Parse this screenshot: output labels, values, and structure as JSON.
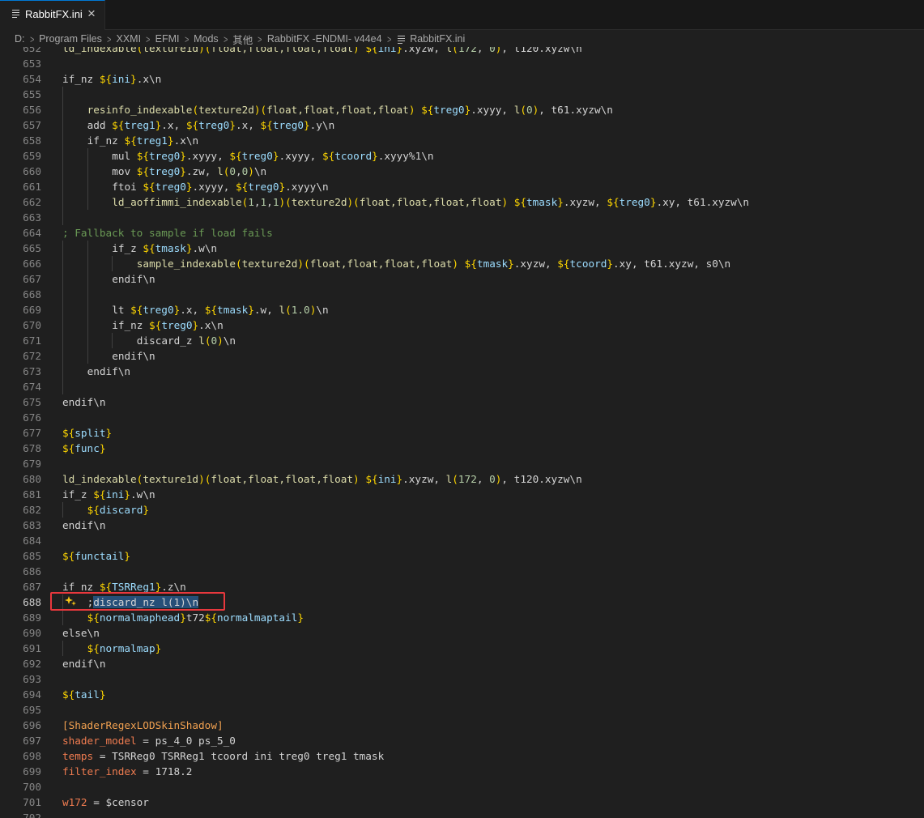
{
  "tab": {
    "label": "RabbitFX.ini",
    "close": "×"
  },
  "breadcrumb": [
    "D:",
    "Program Files",
    "XXMI",
    "EFMI",
    "Mods",
    "其他",
    "RabbitFX -ENDMI- v44e4",
    "RabbitFX.ini"
  ],
  "colors": {
    "active_tab_border": "#0078d4",
    "annotation_box": "#e8383d",
    "selection": "#264f78",
    "editor_bg": "#1f1f1f"
  },
  "editor": {
    "active_line": "688",
    "lines": [
      {
        "n": "652",
        "indent": 0,
        "segs": [
          [
            "ld_indexable",
            "func"
          ],
          [
            "(",
            "brace"
          ],
          [
            "texture1d",
            "func"
          ],
          [
            ")",
            "brace"
          ],
          [
            "(",
            "brace"
          ],
          [
            "float,float,float,float",
            "func"
          ],
          [
            ")",
            "brace"
          ],
          [
            " ",
            ""
          ],
          [
            "${",
            "brace"
          ],
          [
            "ini",
            "var"
          ],
          [
            "}",
            "brace"
          ],
          [
            ".xyzw, ",
            ""
          ],
          [
            "l",
            "func"
          ],
          [
            "(",
            "brace"
          ],
          [
            "172",
            "num"
          ],
          [
            ", ",
            ""
          ],
          [
            "0",
            "num"
          ],
          [
            ")",
            "brace"
          ],
          [
            ", t120.xyzw\\n",
            ""
          ]
        ]
      },
      {
        "n": "653",
        "indent": 0,
        "segs": []
      },
      {
        "n": "654",
        "indent": 0,
        "segs": [
          [
            "if_nz ",
            ""
          ],
          [
            "${",
            "brace"
          ],
          [
            "ini",
            "var"
          ],
          [
            "}",
            "brace"
          ],
          [
            ".x\\n",
            ""
          ]
        ]
      },
      {
        "n": "655",
        "indent": 1,
        "segs": []
      },
      {
        "n": "656",
        "indent": 1,
        "segs": [
          [
            "resinfo_indexable",
            "func"
          ],
          [
            "(",
            "brace"
          ],
          [
            "texture2d",
            "func"
          ],
          [
            ")",
            "brace"
          ],
          [
            "(",
            "brace"
          ],
          [
            "float,float,float,float",
            "func"
          ],
          [
            ")",
            "brace"
          ],
          [
            " ",
            ""
          ],
          [
            "${",
            "brace"
          ],
          [
            "treg0",
            "var"
          ],
          [
            "}",
            "brace"
          ],
          [
            ".xyyy, ",
            ""
          ],
          [
            "l",
            "func"
          ],
          [
            "(",
            "brace"
          ],
          [
            "0",
            "num"
          ],
          [
            ")",
            "brace"
          ],
          [
            ", t61.xyzw\\n",
            ""
          ]
        ]
      },
      {
        "n": "657",
        "indent": 1,
        "segs": [
          [
            "add ",
            ""
          ],
          [
            "${",
            "brace"
          ],
          [
            "treg1",
            "var"
          ],
          [
            "}",
            "brace"
          ],
          [
            ".x, ",
            ""
          ],
          [
            "${",
            "brace"
          ],
          [
            "treg0",
            "var"
          ],
          [
            "}",
            "brace"
          ],
          [
            ".x, ",
            ""
          ],
          [
            "${",
            "brace"
          ],
          [
            "treg0",
            "var"
          ],
          [
            "}",
            "brace"
          ],
          [
            ".y\\n",
            ""
          ]
        ]
      },
      {
        "n": "658",
        "indent": 1,
        "segs": [
          [
            "if_nz ",
            ""
          ],
          [
            "${",
            "brace"
          ],
          [
            "treg1",
            "var"
          ],
          [
            "}",
            "brace"
          ],
          [
            ".x\\n",
            ""
          ]
        ]
      },
      {
        "n": "659",
        "indent": 2,
        "segs": [
          [
            "mul ",
            ""
          ],
          [
            "${",
            "brace"
          ],
          [
            "treg0",
            "var"
          ],
          [
            "}",
            "brace"
          ],
          [
            ".xyyy, ",
            ""
          ],
          [
            "${",
            "brace"
          ],
          [
            "treg0",
            "var"
          ],
          [
            "}",
            "brace"
          ],
          [
            ".xyyy, ",
            ""
          ],
          [
            "${",
            "brace"
          ],
          [
            "tcoord",
            "var"
          ],
          [
            "}",
            "brace"
          ],
          [
            ".xyyy%1\\n",
            ""
          ]
        ]
      },
      {
        "n": "660",
        "indent": 2,
        "segs": [
          [
            "mov ",
            ""
          ],
          [
            "${",
            "brace"
          ],
          [
            "treg0",
            "var"
          ],
          [
            "}",
            "brace"
          ],
          [
            ".zw, ",
            ""
          ],
          [
            "l",
            "func"
          ],
          [
            "(",
            "brace"
          ],
          [
            "0",
            "num"
          ],
          [
            ",",
            ""
          ],
          [
            "0",
            "num"
          ],
          [
            ")",
            "brace"
          ],
          [
            "\\n",
            ""
          ]
        ]
      },
      {
        "n": "661",
        "indent": 2,
        "segs": [
          [
            "ftoi ",
            ""
          ],
          [
            "${",
            "brace"
          ],
          [
            "treg0",
            "var"
          ],
          [
            "}",
            "brace"
          ],
          [
            ".xyyy, ",
            ""
          ],
          [
            "${",
            "brace"
          ],
          [
            "treg0",
            "var"
          ],
          [
            "}",
            "brace"
          ],
          [
            ".xyyy\\n",
            ""
          ]
        ]
      },
      {
        "n": "662",
        "indent": 2,
        "segs": [
          [
            "ld_aoffimmi_indexable",
            "func"
          ],
          [
            "(",
            "brace"
          ],
          [
            "1",
            "num"
          ],
          [
            ",",
            ""
          ],
          [
            "1",
            "num"
          ],
          [
            ",",
            ""
          ],
          [
            "1",
            "num"
          ],
          [
            ")",
            "brace"
          ],
          [
            "(",
            "brace"
          ],
          [
            "texture2d",
            "func"
          ],
          [
            ")",
            "brace"
          ],
          [
            "(",
            "brace"
          ],
          [
            "float,float,float,float",
            "func"
          ],
          [
            ")",
            "brace"
          ],
          [
            " ",
            ""
          ],
          [
            "${",
            "brace"
          ],
          [
            "tmask",
            "var"
          ],
          [
            "}",
            "brace"
          ],
          [
            ".xyzw, ",
            ""
          ],
          [
            "${",
            "brace"
          ],
          [
            "treg0",
            "var"
          ],
          [
            "}",
            "brace"
          ],
          [
            ".xy, t61.xyzw\\n",
            ""
          ]
        ]
      },
      {
        "n": "663",
        "indent": 1,
        "segs": []
      },
      {
        "n": "664",
        "indent": 0,
        "segs": [
          [
            "; Fallback to sample if load fails",
            "comment"
          ]
        ]
      },
      {
        "n": "665",
        "indent": 2,
        "segs": [
          [
            "if_z ",
            ""
          ],
          [
            "${",
            "brace"
          ],
          [
            "tmask",
            "var"
          ],
          [
            "}",
            "brace"
          ],
          [
            ".w\\n",
            ""
          ]
        ]
      },
      {
        "n": "666",
        "indent": 3,
        "segs": [
          [
            "sample_indexable",
            "func"
          ],
          [
            "(",
            "brace"
          ],
          [
            "texture2d",
            "func"
          ],
          [
            ")",
            "brace"
          ],
          [
            "(",
            "brace"
          ],
          [
            "float,float,float,float",
            "func"
          ],
          [
            ")",
            "brace"
          ],
          [
            " ",
            ""
          ],
          [
            "${",
            "brace"
          ],
          [
            "tmask",
            "var"
          ],
          [
            "}",
            "brace"
          ],
          [
            ".xyzw, ",
            ""
          ],
          [
            "${",
            "brace"
          ],
          [
            "tcoord",
            "var"
          ],
          [
            "}",
            "brace"
          ],
          [
            ".xy, t61.xyzw, s0\\n",
            ""
          ]
        ]
      },
      {
        "n": "667",
        "indent": 2,
        "segs": [
          [
            "endif\\n",
            ""
          ]
        ]
      },
      {
        "n": "668",
        "indent": 2,
        "segs": []
      },
      {
        "n": "669",
        "indent": 2,
        "segs": [
          [
            "lt ",
            ""
          ],
          [
            "${",
            "brace"
          ],
          [
            "treg0",
            "var"
          ],
          [
            "}",
            "brace"
          ],
          [
            ".x, ",
            ""
          ],
          [
            "${",
            "brace"
          ],
          [
            "tmask",
            "var"
          ],
          [
            "}",
            "brace"
          ],
          [
            ".w, ",
            ""
          ],
          [
            "l",
            "func"
          ],
          [
            "(",
            "brace"
          ],
          [
            "1.0",
            "num"
          ],
          [
            ")",
            "brace"
          ],
          [
            "\\n",
            ""
          ]
        ]
      },
      {
        "n": "670",
        "indent": 2,
        "segs": [
          [
            "if_nz ",
            ""
          ],
          [
            "${",
            "brace"
          ],
          [
            "treg0",
            "var"
          ],
          [
            "}",
            "brace"
          ],
          [
            ".x\\n",
            ""
          ]
        ]
      },
      {
        "n": "671",
        "indent": 3,
        "segs": [
          [
            "discard_z ",
            ""
          ],
          [
            "l",
            "func"
          ],
          [
            "(",
            "brace"
          ],
          [
            "0",
            "num"
          ],
          [
            ")",
            "brace"
          ],
          [
            "\\n",
            ""
          ]
        ]
      },
      {
        "n": "672",
        "indent": 2,
        "segs": [
          [
            "endif\\n",
            ""
          ]
        ]
      },
      {
        "n": "673",
        "indent": 1,
        "segs": [
          [
            "endif\\n",
            ""
          ]
        ]
      },
      {
        "n": "674",
        "indent": 1,
        "segs": []
      },
      {
        "n": "675",
        "indent": 0,
        "segs": [
          [
            "endif\\n",
            ""
          ]
        ]
      },
      {
        "n": "676",
        "indent": 0,
        "segs": []
      },
      {
        "n": "677",
        "indent": 0,
        "segs": [
          [
            "${",
            "brace"
          ],
          [
            "split",
            "var"
          ],
          [
            "}",
            "brace"
          ]
        ]
      },
      {
        "n": "678",
        "indent": 0,
        "segs": [
          [
            "${",
            "brace"
          ],
          [
            "func",
            "var"
          ],
          [
            "}",
            "brace"
          ]
        ]
      },
      {
        "n": "679",
        "indent": 0,
        "segs": []
      },
      {
        "n": "680",
        "indent": 0,
        "segs": [
          [
            "ld_indexable",
            "func"
          ],
          [
            "(",
            "brace"
          ],
          [
            "texture1d",
            "func"
          ],
          [
            ")",
            "brace"
          ],
          [
            "(",
            "brace"
          ],
          [
            "float,float,float,float",
            "func"
          ],
          [
            ")",
            "brace"
          ],
          [
            " ",
            ""
          ],
          [
            "${",
            "brace"
          ],
          [
            "ini",
            "var"
          ],
          [
            "}",
            "brace"
          ],
          [
            ".xyzw, ",
            ""
          ],
          [
            "l",
            "func"
          ],
          [
            "(",
            "brace"
          ],
          [
            "172",
            "num"
          ],
          [
            ", ",
            ""
          ],
          [
            "0",
            "num"
          ],
          [
            ")",
            "brace"
          ],
          [
            ", t120.xyzw\\n",
            ""
          ]
        ]
      },
      {
        "n": "681",
        "indent": 0,
        "segs": [
          [
            "if_z ",
            ""
          ],
          [
            "${",
            "brace"
          ],
          [
            "ini",
            "var"
          ],
          [
            "}",
            "brace"
          ],
          [
            ".w\\n",
            ""
          ]
        ]
      },
      {
        "n": "682",
        "indent": 1,
        "segs": [
          [
            "${",
            "brace"
          ],
          [
            "discard",
            "var"
          ],
          [
            "}",
            "brace"
          ]
        ]
      },
      {
        "n": "683",
        "indent": 0,
        "segs": [
          [
            "endif\\n",
            ""
          ]
        ]
      },
      {
        "n": "684",
        "indent": 0,
        "segs": []
      },
      {
        "n": "685",
        "indent": 0,
        "segs": [
          [
            "${",
            "brace"
          ],
          [
            "functail",
            "var"
          ],
          [
            "}",
            "brace"
          ]
        ]
      },
      {
        "n": "686",
        "indent": 0,
        "segs": []
      },
      {
        "n": "687",
        "indent": 0,
        "segs": [
          [
            "if_nz ",
            ""
          ],
          [
            "${",
            "brace"
          ],
          [
            "TSRReg1",
            "var"
          ],
          [
            "}",
            "brace"
          ],
          [
            ".z\\n",
            ""
          ]
        ]
      },
      {
        "n": "688",
        "indent": 1,
        "segs": [
          [
            ";",
            ""
          ],
          [
            "discard_nz l(1)\\n",
            "sel"
          ]
        ]
      },
      {
        "n": "689",
        "indent": 1,
        "segs": [
          [
            "${",
            "brace"
          ],
          [
            "normalmaphead",
            "var"
          ],
          [
            "}",
            "brace"
          ],
          [
            "t72",
            ""
          ],
          [
            "${",
            "brace"
          ],
          [
            "normalmaptail",
            "var"
          ],
          [
            "}",
            "brace"
          ]
        ]
      },
      {
        "n": "690",
        "indent": 0,
        "segs": [
          [
            "else\\n",
            ""
          ]
        ]
      },
      {
        "n": "691",
        "indent": 1,
        "segs": [
          [
            "${",
            "brace"
          ],
          [
            "normalmap",
            "var"
          ],
          [
            "}",
            "brace"
          ]
        ]
      },
      {
        "n": "692",
        "indent": 0,
        "segs": [
          [
            "endif\\n",
            ""
          ]
        ]
      },
      {
        "n": "693",
        "indent": 0,
        "segs": []
      },
      {
        "n": "694",
        "indent": 0,
        "segs": [
          [
            "${",
            "brace"
          ],
          [
            "tail",
            "var"
          ],
          [
            "}",
            "brace"
          ]
        ]
      },
      {
        "n": "695",
        "indent": 0,
        "segs": []
      },
      {
        "n": "696",
        "indent": 0,
        "segs": [
          [
            "[ShaderRegexLODSkinShadow]",
            "section"
          ]
        ]
      },
      {
        "n": "697",
        "indent": 0,
        "segs": [
          [
            "shader_model",
            "key"
          ],
          [
            " = ps_4_0 ps_5_0",
            ""
          ]
        ]
      },
      {
        "n": "698",
        "indent": 0,
        "segs": [
          [
            "temps",
            "key"
          ],
          [
            " = TSRReg0 TSRReg1 tcoord ini treg0 treg1 tmask",
            ""
          ]
        ]
      },
      {
        "n": "699",
        "indent": 0,
        "segs": [
          [
            "filter_index",
            "key"
          ],
          [
            " = 1718.2",
            ""
          ]
        ]
      },
      {
        "n": "700",
        "indent": 0,
        "segs": []
      },
      {
        "n": "701",
        "indent": 0,
        "segs": [
          [
            "w172",
            "key"
          ],
          [
            " = $censor",
            ""
          ]
        ]
      },
      {
        "n": "702",
        "indent": 0,
        "segs": []
      }
    ]
  }
}
